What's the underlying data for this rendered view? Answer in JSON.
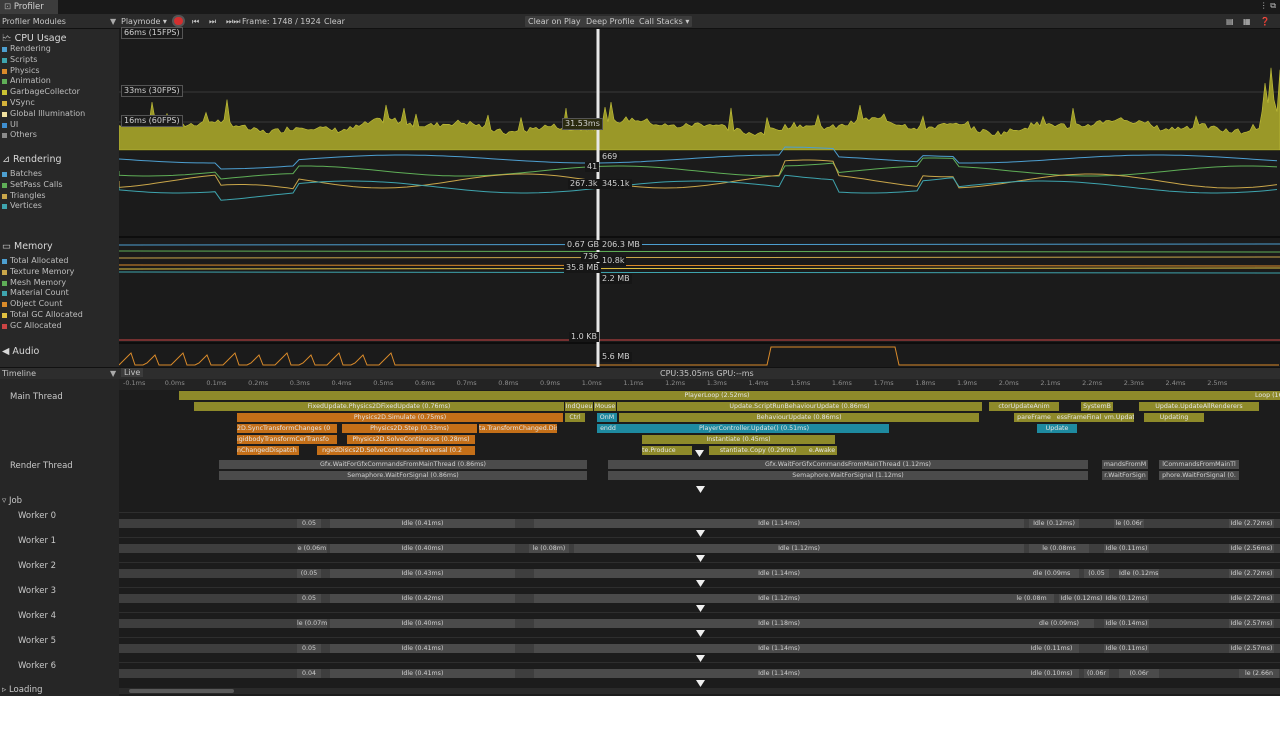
{
  "window": {
    "tab_title": "Profiler",
    "menu_glyph": "⋮ ⧉"
  },
  "toolbar": {
    "modules_label": "Profiler Modules",
    "playmode_label": "Playmode ▾",
    "frame_label": "Frame: 1748 / 1924",
    "clear_label": "Clear",
    "clear_on_play_label": "Clear on Play",
    "deep_profile_label": "Deep Profile",
    "call_stacks_label": "Call Stacks ▾",
    "icons": [
      "record-icon",
      "step-back-icon",
      "step-forward-icon",
      "jump-end-icon",
      "load-icon",
      "save-icon",
      "help-icon"
    ]
  },
  "modules": {
    "cpu": {
      "title": "CPU Usage",
      "items": [
        "Rendering",
        "Scripts",
        "Physics",
        "Animation",
        "GarbageCollector",
        "VSync",
        "Global Illumination",
        "UI",
        "Others"
      ],
      "colors": [
        "#4d9fd0",
        "#3ea4ae",
        "#d98a2a",
        "#5fae57",
        "#c9c233",
        "#d4b23a",
        "#f0e0a0",
        "#3e8ed0",
        "#8a8a8a"
      ],
      "fps_labels": [
        "66ms (15FPS)",
        "33ms (30FPS)",
        "16ms (60FPS)"
      ],
      "cursor_value": "31.53ms"
    },
    "rendering": {
      "title": "Rendering",
      "items": [
        "Batches",
        "SetPass Calls",
        "Triangles",
        "Vertices"
      ],
      "colors": [
        "#4d9fd0",
        "#5fae57",
        "#c9a64a",
        "#3ea4ae"
      ],
      "values_left": [
        "41",
        "267.3k"
      ],
      "values_right": [
        "669",
        "345.1k"
      ]
    },
    "memory": {
      "title": "Memory",
      "items": [
        "Total Allocated",
        "Texture Memory",
        "Mesh Memory",
        "Material Count",
        "Object Count",
        "Total GC Allocated",
        "GC Allocated"
      ],
      "colors": [
        "#4d9fd0",
        "#c9a64a",
        "#5fae57",
        "#3ea4ae",
        "#d98a2a",
        "#e0c040",
        "#c44"
      ],
      "values_left": [
        "0.67 GB",
        "736",
        "35.8 MB",
        "1.0 KB"
      ],
      "values_right": [
        "206.3 MB",
        "10.8k",
        "2.2 MB",
        "5.6 MB"
      ]
    },
    "audio": {
      "title": "Audio"
    }
  },
  "timeline": {
    "view_label": "Timeline",
    "live_label": "Live",
    "summary": "CPU:35.05ms  GPU:--ms",
    "ruler": [
      "-0.1ms",
      "0.0ms",
      "0.1ms",
      "0.2ms",
      "0.3ms",
      "0.4ms",
      "0.5ms",
      "0.6ms",
      "0.7ms",
      "0.8ms",
      "0.9ms",
      "1.0ms",
      "1.1ms",
      "1.2ms",
      "1.3ms",
      "1.4ms",
      "1.5ms",
      "1.6ms",
      "1.7ms",
      "1.8ms",
      "1.9ms",
      "2.0ms",
      "2.1ms",
      "2.2ms",
      "2.3ms",
      "2.4ms",
      "2.5ms"
    ],
    "threads": {
      "main": "Main Thread",
      "render": "Render Thread",
      "job_group": "Job",
      "workers": [
        "Worker 0",
        "Worker 1",
        "Worker 2",
        "Worker 3",
        "Worker 4",
        "Worker 5",
        "Worker 6"
      ],
      "loading": "Loading"
    },
    "main_blocks": {
      "playerloop": "PlayerLoop (2.52ms)",
      "loop_right": "Loop (16",
      "fixed_update": "FixedUpdate.Physics2DFixedUpdate (0.76ms)",
      "ind_queue": "IndQueu",
      "mouse": "Mouse",
      "update": "Update.ScriptRunBehaviourUpdate (0.86ms)",
      "ctor_update": "ctorUpdateAnim",
      "system_b": "SystemB",
      "update_renderers": "Update.UpdateAllRenderers",
      "physics_sim": "Physics2D.Simulate (0.75ms)",
      "ctrl": "Ctrl",
      "onm": "OnM",
      "behaviour_update": "BehaviourUpdate (0.86ms)",
      "director": "ectorUpdate",
      "frame_prep": "pareFrame",
      "essframe": "essFrameFinal",
      "vm_update": "vm.Update",
      "updating": "Updating",
      "sync_transforms": "2D.SyncTransformChanges (0",
      "step": "Physics2D.Step (0.33ms)",
      "ta_changed": "ta.TransformChanged.Dispa",
      "ndd": "endd",
      "player_controller": "PlayerController.Update() (0.51ms)",
      "update_small": "Update",
      "rigidbody": "igidbodyTransformCerTransfo",
      "solve_cont": "Physics2D.SolveContinuous (0.28ms)",
      "instantiate": "Instantiate (0.45ms)",
      "changed_dispatch": "nChangedDispatch",
      "nged_disp": "ngedDisp",
      "solve_cont_trav": "ics2D.SolveContinuousTraversal (0.2",
      "te_produce": "te.Produce",
      "inst_copy": "stantiate.Copy (0.29ms)",
      "awake": "e.Awake"
    },
    "render_blocks": {
      "wait1": "Gfx.WaitForGfxCommandsFromMainThread (0.86ms)",
      "sem1": "Semaphore.WaitForSignal (0.86ms)",
      "wait2": "Gfx.WaitForGfxCommandsFromMainThread (1.12ms)",
      "sem2": "Semaphore.WaitForSignal (1.12ms)",
      "wait3": "mandsFromM",
      "sem3": "r.WaitForSign",
      "wait4": "lCommandsFromMainTl",
      "sem4": "phore.WaitForSignal (0."
    },
    "worker_rows": [
      [
        [
          "0.05",
          ""
        ],
        [
          "Idle (0.41ms)"
        ],
        [
          "Idle (1.14ms)"
        ],
        [
          "Idle (0.12ms)"
        ],
        [
          "le (0.06r"
        ],
        [
          "Idle (2.72ms)"
        ]
      ],
      [
        [
          "e (0.06m",
          ""
        ],
        [
          "Idle (0.40ms)"
        ],
        [
          "le (0.08m)"
        ],
        [
          "Idle (1.12ms)"
        ],
        [
          "le (0.08ms"
        ],
        [
          "Idle (0.11ms)"
        ],
        [
          "Idle (2.56ms)"
        ]
      ],
      [
        [
          "(0.05",
          ""
        ],
        [
          "Idle (0.43ms)"
        ],
        [
          "Idle (1.14ms)"
        ],
        [
          "dle (0.09ms"
        ],
        [
          "(0.05"
        ],
        [
          "Idle (0.12ms)"
        ],
        [
          "Idle (2.72ms)"
        ]
      ],
      [
        [
          "0.05",
          ""
        ],
        [
          "Idle (0.42ms)"
        ],
        [
          "Idle (1.12ms)"
        ],
        [
          "le (0.08m"
        ],
        [
          "Idle (0.12ms)"
        ],
        [
          "Idle (0.12ms)"
        ],
        [
          "Idle (2.72ms)"
        ]
      ],
      [
        [
          "le (0.07m",
          ""
        ],
        [
          "Idle (0.40ms)"
        ],
        [
          "Idle (1.18ms)"
        ],
        [
          "dle (0.09ms)"
        ],
        [
          "Idle (0.14ms)"
        ],
        [
          "Idle (2.57ms)"
        ]
      ],
      [
        [
          "0.05",
          ""
        ],
        [
          "Idle (0.41ms)"
        ],
        [
          "Idle (1.14ms)"
        ],
        [
          "Idle (0.11ms)"
        ],
        [
          "Idle (0.11ms)"
        ],
        [
          "Idle (2.57ms)"
        ]
      ],
      [
        [
          "0.04",
          ""
        ],
        [
          "Idle (0.41ms)"
        ],
        [
          "Idle (1.14ms)"
        ],
        [
          "Idle (0.10ms)"
        ],
        [
          "(0.06r"
        ],
        [
          "(0.06r"
        ],
        [
          "le (2.66n"
        ]
      ]
    ]
  }
}
